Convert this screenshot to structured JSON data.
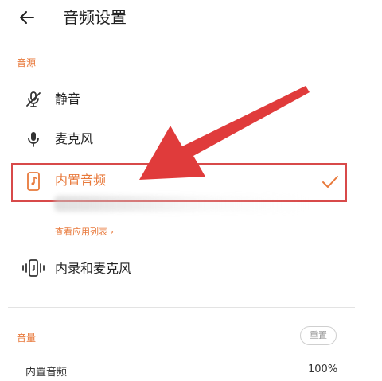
{
  "header": {
    "title": "音频设置"
  },
  "source_section": {
    "label": "音源",
    "items": [
      {
        "label": "静音",
        "icon": "mic-off-icon",
        "selected": false
      },
      {
        "label": "麦克风",
        "icon": "microphone-icon",
        "selected": false
      },
      {
        "label": "内置音频",
        "icon": "phone-music-icon",
        "selected": true
      },
      {
        "label": "内录和麦克风",
        "icon": "phone-vibrate-icon",
        "selected": false
      }
    ],
    "view_apps_link": "查看应用列表 ›"
  },
  "volume_section": {
    "label": "音量",
    "reset_label": "重置",
    "internal_audio_label": "内置音频",
    "internal_audio_value": "100%"
  },
  "colors": {
    "accent": "#E8793B",
    "annotation": "#E03B3B"
  }
}
